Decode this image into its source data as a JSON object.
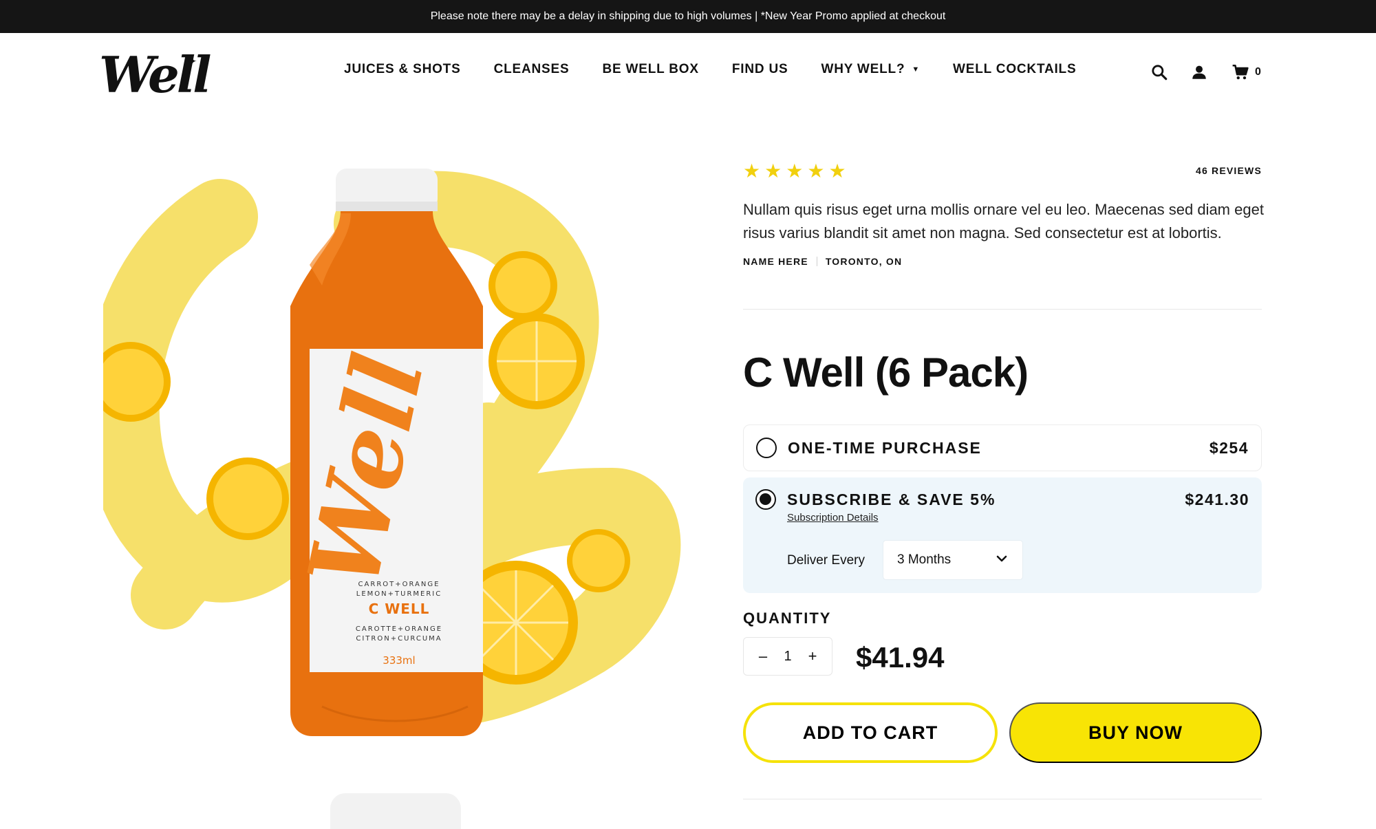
{
  "announcement": "Please note there may be a delay in shipping due to high volumes | *New Year Promo applied at checkout",
  "brand": {
    "logo_text": "Well"
  },
  "nav": {
    "items": [
      {
        "label": "JUICES & SHOTS"
      },
      {
        "label": "CLEANSES"
      },
      {
        "label": "BE WELL BOX"
      },
      {
        "label": "FIND US"
      },
      {
        "label": "WHY WELL?",
        "has_dropdown": true
      },
      {
        "label": "WELL COCKTAILS"
      }
    ]
  },
  "header_icons": {
    "search": "search-icon",
    "account": "user-icon",
    "cart": "cart-icon",
    "cart_count": "0"
  },
  "product_image": {
    "label_brand": "Well",
    "label_lines": [
      "CARROT+ORANGE",
      "LEMON+TURMERIC",
      "C WELL",
      "CAROTTE+ORANGE",
      "CITRON+CURCUMA",
      "333ml"
    ]
  },
  "review": {
    "rating": 5,
    "count_label": "46 REVIEWS",
    "text": "Nullam quis risus eget urna mollis ornare vel eu leo. Maecenas sed diam eget risus varius blandit sit amet non magna. Sed consectetur est at lobortis.",
    "name": "NAME HERE",
    "location": "TORONTO, ON"
  },
  "product": {
    "title": "C Well (6 Pack)",
    "options": {
      "one_time_label": "ONE-TIME PURCHASE",
      "one_time_price": "$254",
      "subscribe_label": "SUBSCRIBE & SAVE 5%",
      "subscribe_price": "$241.30",
      "subscription_link": "Subscription Details",
      "deliver_label": "Deliver Every",
      "deliver_value": "3 Months",
      "selected": "subscribe"
    },
    "quantity_label": "QUANTITY",
    "quantity": "1",
    "minus": "–",
    "plus": "+",
    "unit_price": "$41.94",
    "add_to_cart": "ADD TO CART",
    "buy_now": "BUY NOW"
  },
  "colors": {
    "accent_yellow": "#f8e405",
    "star": "#f1d00e",
    "subscribe_bg": "#eef6fb",
    "bar": "#151515",
    "bottle_orange": "#e8710f"
  }
}
